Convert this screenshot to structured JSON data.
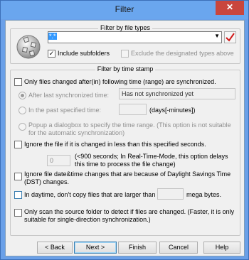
{
  "window": {
    "title": "Filter",
    "close_glyph": "✕"
  },
  "filetypes": {
    "legend": "Filter by file types",
    "filter_value": "*.*",
    "include_subfolders_label": "Include subfolders",
    "include_subfolders_checked": true,
    "exclude_label": "Exclude the designated types above",
    "exclude_checked": false,
    "confirm_icon": "red-checkmark-icon"
  },
  "timestamp": {
    "legend": "Filter by time stamp",
    "only_changed_label": "Only files changed after(in) following time (range) are synchronized.",
    "only_changed_checked": false,
    "after_last_label": "After last synchronized time:",
    "after_last_value": "Has not synchronized yet",
    "past_time_label": "In the past specified time:",
    "past_time_value": "",
    "past_time_units": "(days[-minutes])",
    "popup_label": "Popup a dialogbox to specify the time range. (This option is not suitable for the automatic synchronization)"
  },
  "options": {
    "ignore_changed_label": "Ignore the file if it is changed in less than this specified seconds.",
    "ignore_changed_checked": false,
    "seconds_value": "0",
    "seconds_note": "(<900 seconds; In Real-Time-Mode, this option delays this time to process the file change)",
    "dst_label": "Ignore file date&time changes that are because of Daylight Savings Time (DST) changes.",
    "dst_checked": false,
    "daytime_label": "In daytime, don't copy files that are larger than",
    "daytime_value": "",
    "daytime_units": "mega bytes.",
    "daytime_checked": false,
    "scan_source_label": "Only scan the source folder to detect if files are changed. (Faster, it is only suitable for single-direction synchronization.)",
    "scan_source_checked": false
  },
  "buttons": {
    "back": "< Back",
    "next": "Next >",
    "finish": "Finish",
    "cancel": "Cancel",
    "help": "Help"
  }
}
